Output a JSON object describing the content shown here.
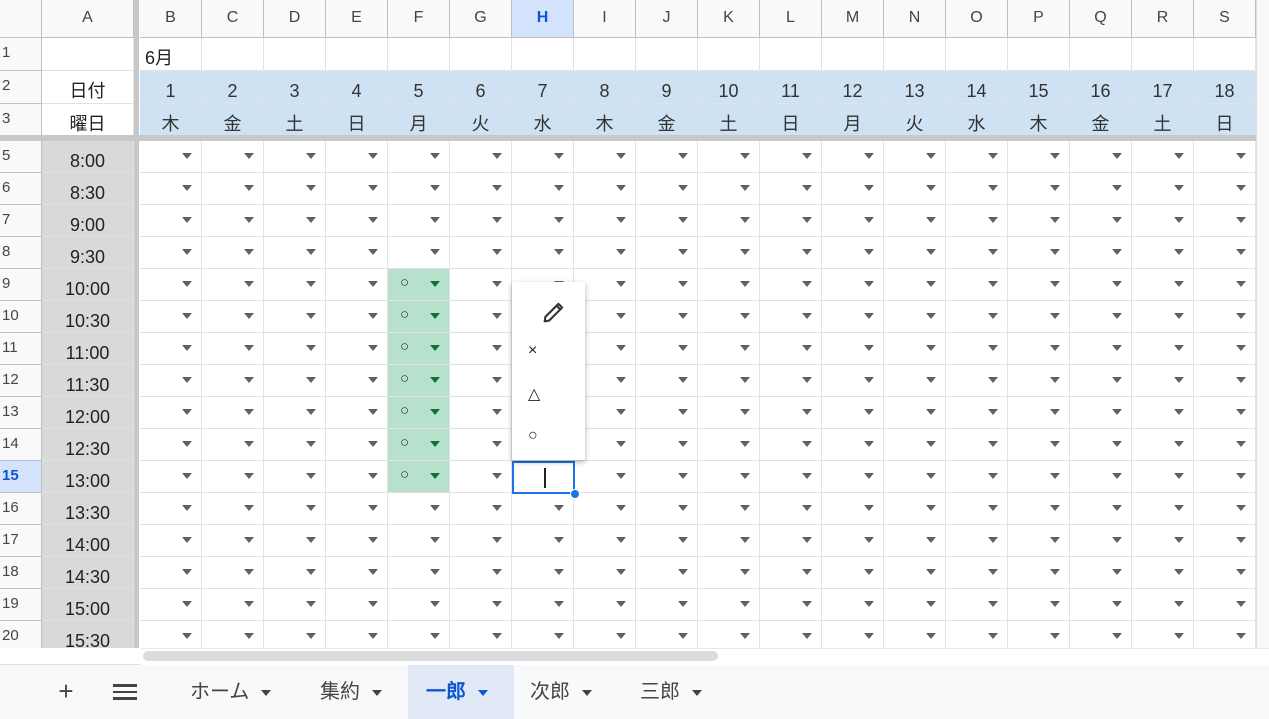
{
  "columns": [
    "A",
    "B",
    "C",
    "D",
    "E",
    "F",
    "G",
    "H",
    "I",
    "J",
    "K",
    "L",
    "M",
    "N",
    "O",
    "P",
    "Q",
    "R",
    "S"
  ],
  "active_column": "H",
  "active_row": "15",
  "month_label": "6月",
  "date_label": "日付",
  "weekday_label": "曜日",
  "dates": [
    "1",
    "2",
    "3",
    "4",
    "5",
    "6",
    "7",
    "8",
    "9",
    "10",
    "11",
    "12",
    "13",
    "14",
    "15",
    "16",
    "17",
    "18"
  ],
  "weekdays": [
    "木",
    "金",
    "土",
    "日",
    "月",
    "火",
    "水",
    "木",
    "金",
    "土",
    "日",
    "月",
    "火",
    "水",
    "木",
    "金",
    "土",
    "日"
  ],
  "top_rows": [
    "1",
    "2",
    "3"
  ],
  "rows": [
    {
      "num": "5",
      "time": "8:00"
    },
    {
      "num": "6",
      "time": "8:30"
    },
    {
      "num": "7",
      "time": "9:00"
    },
    {
      "num": "8",
      "time": "9:30"
    },
    {
      "num": "9",
      "time": "10:00",
      "f": "○"
    },
    {
      "num": "10",
      "time": "10:30",
      "f": "○"
    },
    {
      "num": "11",
      "time": "11:00",
      "f": "○"
    },
    {
      "num": "12",
      "time": "11:30",
      "f": "○"
    },
    {
      "num": "13",
      "time": "12:00",
      "f": "○"
    },
    {
      "num": "14",
      "time": "12:30",
      "f": "○"
    },
    {
      "num": "15",
      "time": "13:00",
      "f": "○"
    },
    {
      "num": "16",
      "time": "13:30"
    },
    {
      "num": "17",
      "time": "14:00"
    },
    {
      "num": "18",
      "time": "14:30"
    },
    {
      "num": "19",
      "time": "15:00"
    },
    {
      "num": "20",
      "time": "15:30"
    }
  ],
  "dropdown_menu": {
    "edit_icon": "pencil-icon",
    "options": [
      "×",
      "△",
      "○"
    ]
  },
  "colors": {
    "header_blue": "#cfe2f3",
    "green_fill": "#b7e1cd",
    "time_gray": "#d9d9d9",
    "selection_blue": "#1a73e8"
  },
  "tabs": {
    "add_label": "+",
    "list_icon": "list-icon",
    "items": [
      {
        "label": "ホーム",
        "active": false
      },
      {
        "label": "集約",
        "active": false
      },
      {
        "label": "一郎",
        "active": true
      },
      {
        "label": "次郎",
        "active": false
      },
      {
        "label": "三郎",
        "active": false
      }
    ]
  }
}
